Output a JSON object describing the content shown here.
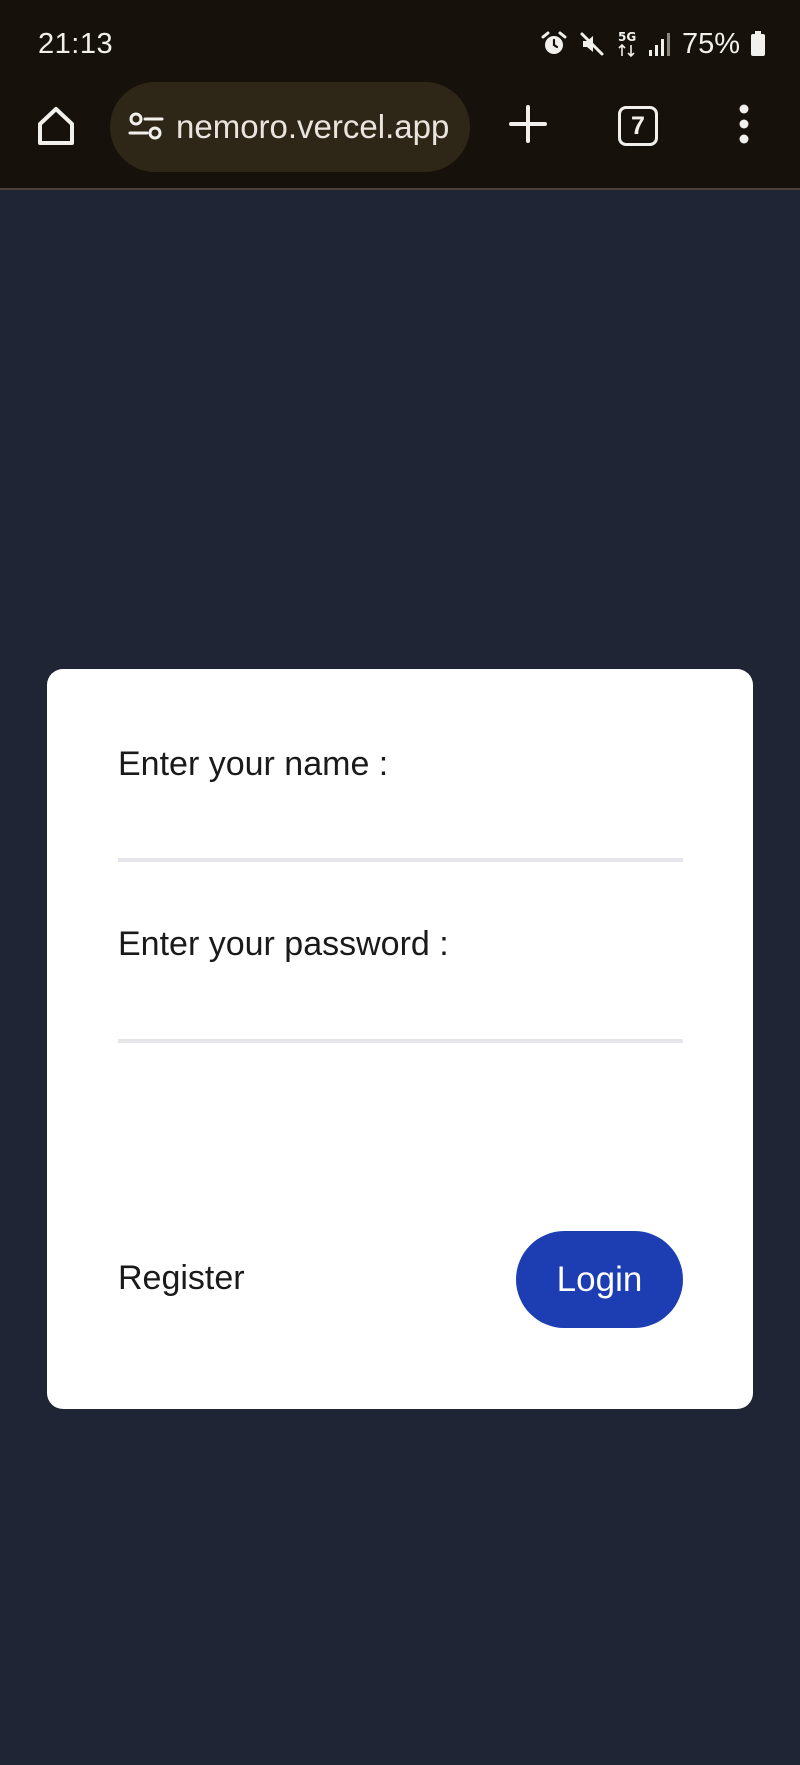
{
  "status_bar": {
    "time": "21:13",
    "network": "5G",
    "battery": "75%",
    "icons": [
      "alarm-icon",
      "mute-icon",
      "5g-icon",
      "signal-icon",
      "battery-icon"
    ]
  },
  "browser": {
    "url": "nemoro.vercel.app",
    "tab_count": "7",
    "icons": [
      "home-icon",
      "tune-icon",
      "plus-icon",
      "more-vert-icon"
    ]
  },
  "login_form": {
    "name_label": "Enter your name :",
    "name_value": "",
    "password_label": "Enter your password :",
    "password_value": "",
    "register_label": "Register",
    "login_label": "Login"
  },
  "colors": {
    "page_background": "#1f2535",
    "browser_chrome": "#16110a",
    "url_pill": "#2e2718",
    "card_background": "#ffffff",
    "login_button": "#1d3db3",
    "input_underline": "#e6e6ea"
  }
}
